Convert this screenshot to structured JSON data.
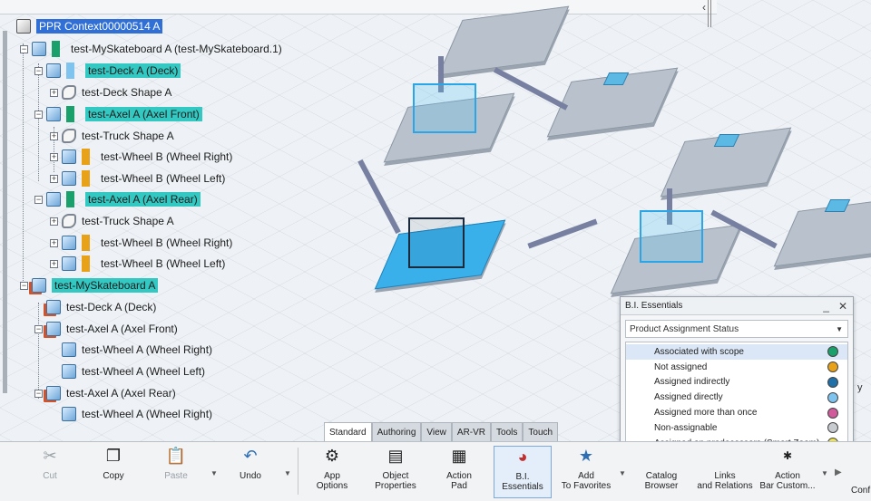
{
  "tree": {
    "rows": [
      {
        "label": "PPR Context00000514 A",
        "style": "sel"
      },
      {
        "label": "test-MySkateboard A (test-MySkateboard.1)",
        "swatch": "#1aa06a"
      },
      {
        "label": "test-Deck A (Deck)",
        "swatch": "#7fc4ef",
        "style": "hl"
      },
      {
        "label": "test-Deck Shape A"
      },
      {
        "label": "test-Axel A (Axel Front)",
        "swatch": "#1aa06a",
        "style": "hl"
      },
      {
        "label": "test-Truck Shape A"
      },
      {
        "label": "test-Wheel B (Wheel Right)",
        "swatch": "#e8a21a"
      },
      {
        "label": "test-Wheel B (Wheel Left)",
        "swatch": "#e8a21a"
      },
      {
        "label": "test-Axel A (Axel Rear)",
        "swatch": "#1aa06a",
        "style": "hl"
      },
      {
        "label": "test-Truck Shape A"
      },
      {
        "label": "test-Wheel B (Wheel Right)",
        "swatch": "#e8a21a"
      },
      {
        "label": "test-Wheel B (Wheel Left)",
        "swatch": "#e8a21a"
      },
      {
        "label": "test-MySkateboard A",
        "style": "hl"
      },
      {
        "label": "test-Deck A (Deck)"
      },
      {
        "label": "test-Axel A (Axel Front)"
      },
      {
        "label": "test-Wheel A (Wheel Right)"
      },
      {
        "label": "test-Wheel A (Wheel Left)"
      },
      {
        "label": "test-Axel A (Axel Rear)"
      },
      {
        "label": "test-Wheel A (Wheel Right)"
      }
    ]
  },
  "bi_panel": {
    "title": "B.I. Essentials",
    "minimize_label": "_",
    "close_label": "✕",
    "selected_option": "Product Assignment Status",
    "legend": [
      {
        "label": "Associated with scope",
        "color": "#1aa06a"
      },
      {
        "label": "Not assigned",
        "color": "#e8a21a"
      },
      {
        "label": "Assigned indirectly",
        "color": "#1f6fa8"
      },
      {
        "label": "Assigned directly",
        "color": "#7fc4ef"
      },
      {
        "label": "Assigned more than once",
        "color": "#d05a9a"
      },
      {
        "label": "Non-assignable",
        "color": "#c8ccd0"
      },
      {
        "label": "Assigned on predecessors (Smart Zoom)",
        "color": "#f0e24a"
      }
    ]
  },
  "tabs": [
    "Standard",
    "Authoring",
    "View",
    "AR-VR",
    "Tools",
    "Touch"
  ],
  "active_tab": "Standard",
  "ribbon": {
    "cut": "Cut",
    "copy": "Copy",
    "paste": "Paste",
    "undo": "Undo",
    "app_options": "App\nOptions",
    "object_properties": "Object\nProperties",
    "action_pad": "Action\nPad",
    "bi_essentials": "B.I.\nEssentials",
    "add_favorites": "Add\nTo Favorites",
    "catalog_browser": "Catalog\nBrowser",
    "links_relations": "Links\nand Relations",
    "action_bar": "Action\nBar Custom...",
    "conf": "Conf"
  },
  "viewport": {
    "side_label": "y"
  }
}
